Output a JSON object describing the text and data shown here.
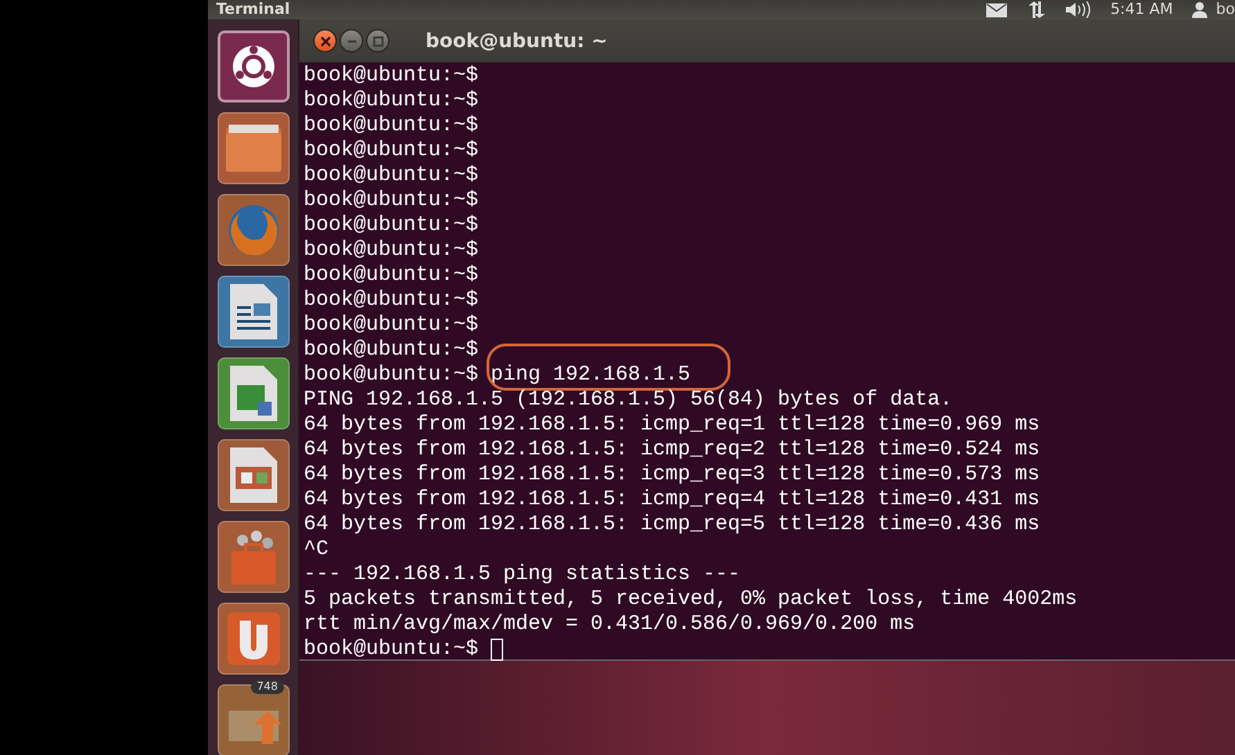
{
  "top_panel": {
    "app_name": "Terminal",
    "clock": "5:41 AM",
    "user": "bo"
  },
  "launcher": {
    "items": [
      {
        "kind": "home",
        "selected": true
      },
      {
        "kind": "files",
        "selected": false
      },
      {
        "kind": "browser",
        "selected": false
      },
      {
        "kind": "writer",
        "selected": false
      },
      {
        "kind": "calc",
        "selected": false
      },
      {
        "kind": "impress",
        "selected": false
      },
      {
        "kind": "software",
        "selected": false
      },
      {
        "kind": "one",
        "selected": false
      },
      {
        "kind": "update",
        "selected": false,
        "badge": "748"
      }
    ]
  },
  "window": {
    "title": "book@ubuntu: ~"
  },
  "terminal": {
    "lines": [
      {
        "kind": "prompt",
        "prompt": "book@ubuntu:~$",
        "highlighted": false,
        "cursor": false
      },
      {
        "kind": "prompt",
        "prompt": "book@ubuntu:~$",
        "highlighted": false,
        "cursor": false
      },
      {
        "kind": "prompt",
        "prompt": "book@ubuntu:~$",
        "highlighted": false,
        "cursor": false
      },
      {
        "kind": "prompt",
        "prompt": "book@ubuntu:~$",
        "highlighted": false,
        "cursor": false
      },
      {
        "kind": "prompt",
        "prompt": "book@ubuntu:~$",
        "highlighted": false,
        "cursor": false
      },
      {
        "kind": "prompt",
        "prompt": "book@ubuntu:~$",
        "highlighted": false,
        "cursor": false
      },
      {
        "kind": "prompt",
        "prompt": "book@ubuntu:~$",
        "highlighted": false,
        "cursor": false
      },
      {
        "kind": "prompt",
        "prompt": "book@ubuntu:~$",
        "highlighted": false,
        "cursor": false
      },
      {
        "kind": "prompt",
        "prompt": "book@ubuntu:~$",
        "highlighted": false,
        "cursor": false
      },
      {
        "kind": "prompt",
        "prompt": "book@ubuntu:~$",
        "highlighted": false,
        "cursor": false
      },
      {
        "kind": "prompt",
        "prompt": "book@ubuntu:~$",
        "highlighted": false,
        "cursor": false
      },
      {
        "kind": "prompt",
        "prompt": "book@ubuntu:~$",
        "highlighted": false,
        "cursor": false
      },
      {
        "kind": "prompt",
        "prompt": "book@ubuntu:~$",
        "command": "ping 192.168.1.5",
        "highlighted": true,
        "cursor": false
      },
      {
        "kind": "output",
        "text": "PING 192.168.1.5 (192.168.1.5) 56(84) bytes of data."
      },
      {
        "kind": "output",
        "text": "64 bytes from 192.168.1.5: icmp_req=1 ttl=128 time=0.969 ms"
      },
      {
        "kind": "output",
        "text": "64 bytes from 192.168.1.5: icmp_req=2 ttl=128 time=0.524 ms"
      },
      {
        "kind": "output",
        "text": "64 bytes from 192.168.1.5: icmp_req=3 ttl=128 time=0.573 ms"
      },
      {
        "kind": "output",
        "text": "64 bytes from 192.168.1.5: icmp_req=4 ttl=128 time=0.431 ms"
      },
      {
        "kind": "output",
        "text": "64 bytes from 192.168.1.5: icmp_req=5 ttl=128 time=0.436 ms"
      },
      {
        "kind": "output",
        "text": "^C"
      },
      {
        "kind": "output",
        "text": "--- 192.168.1.5 ping statistics ---"
      },
      {
        "kind": "output",
        "text": "5 packets transmitted, 5 received, 0% packet loss, time 4002ms"
      },
      {
        "kind": "output",
        "text": "rtt min/avg/max/mdev = 0.431/0.586/0.969/0.200 ms"
      },
      {
        "kind": "prompt",
        "prompt": "book@ubuntu:~$",
        "highlighted": false,
        "cursor": true
      }
    ]
  }
}
